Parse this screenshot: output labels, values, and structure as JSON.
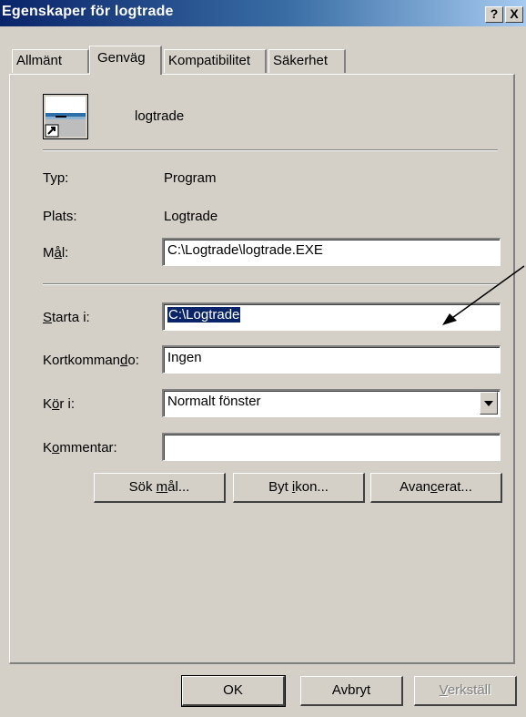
{
  "window": {
    "title": "Egenskaper för logtrade",
    "help_btn": "?",
    "close_btn": "X"
  },
  "tabs": [
    {
      "label": "Allmänt"
    },
    {
      "label": "Genväg"
    },
    {
      "label": "Kompatibilitet"
    },
    {
      "label": "Säkerhet"
    }
  ],
  "shortcut": {
    "name": "logtrade"
  },
  "info": {
    "typ_label": "Typ:",
    "typ_value": "Program",
    "plats_label": "Plats:",
    "plats_value": "Logtrade",
    "mal_label_pre": "M",
    "mal_label_u": "å",
    "mal_label_post": "l:",
    "mal_value": "C:\\Logtrade\\logtrade.EXE"
  },
  "fields": {
    "starta_label_u": "S",
    "starta_label_post": "tarta i:",
    "starta_value": "C:\\Logtrade",
    "kort_label_pre": "Kortkomman",
    "kort_label_u": "d",
    "kort_label_post": "o:",
    "kort_value": "Ingen",
    "kor_label_pre": "K",
    "kor_label_u": "ö",
    "kor_label_post": "r i:",
    "kor_value": "Normalt fönster",
    "komm_label_pre": "K",
    "komm_label_u": "o",
    "komm_label_post": "mmentar:",
    "komm_value": ""
  },
  "buttons": {
    "sok_pre": "Sök ",
    "sok_u": "m",
    "sok_post": "ål...",
    "byt_pre": "Byt ",
    "byt_u": "i",
    "byt_post": "kon...",
    "avan_pre": "Avan",
    "avan_u": "c",
    "avan_post": "erat..."
  },
  "footer": {
    "ok": "OK",
    "avbryt": "Avbryt",
    "verk_u": "V",
    "verk_post": "erkställ"
  }
}
